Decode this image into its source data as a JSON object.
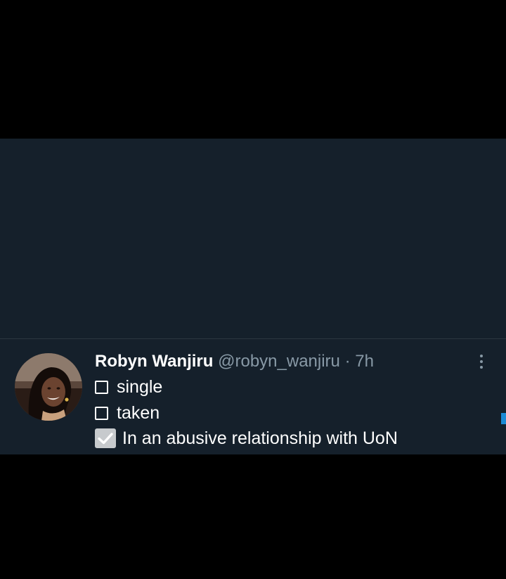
{
  "tweet": {
    "display_name": "Robyn Wanjiru",
    "handle": "@robyn_wanjiru",
    "separator": "·",
    "time": "7h",
    "options": [
      {
        "label": "single",
        "checked": false,
        "icon": "empty-checkbox-icon"
      },
      {
        "label": "taken",
        "checked": false,
        "icon": "empty-checkbox-icon"
      },
      {
        "label": "In an abusive relationship with UoN",
        "checked": true,
        "icon": "checked-checkbox-icon"
      }
    ],
    "more_icon": "more-vertical-icon"
  },
  "colors": {
    "background": "#15202b",
    "letterbox": "#000000",
    "primary_text": "#ffffff",
    "secondary_text": "#8899a6",
    "accent": "#1d8ad4"
  }
}
